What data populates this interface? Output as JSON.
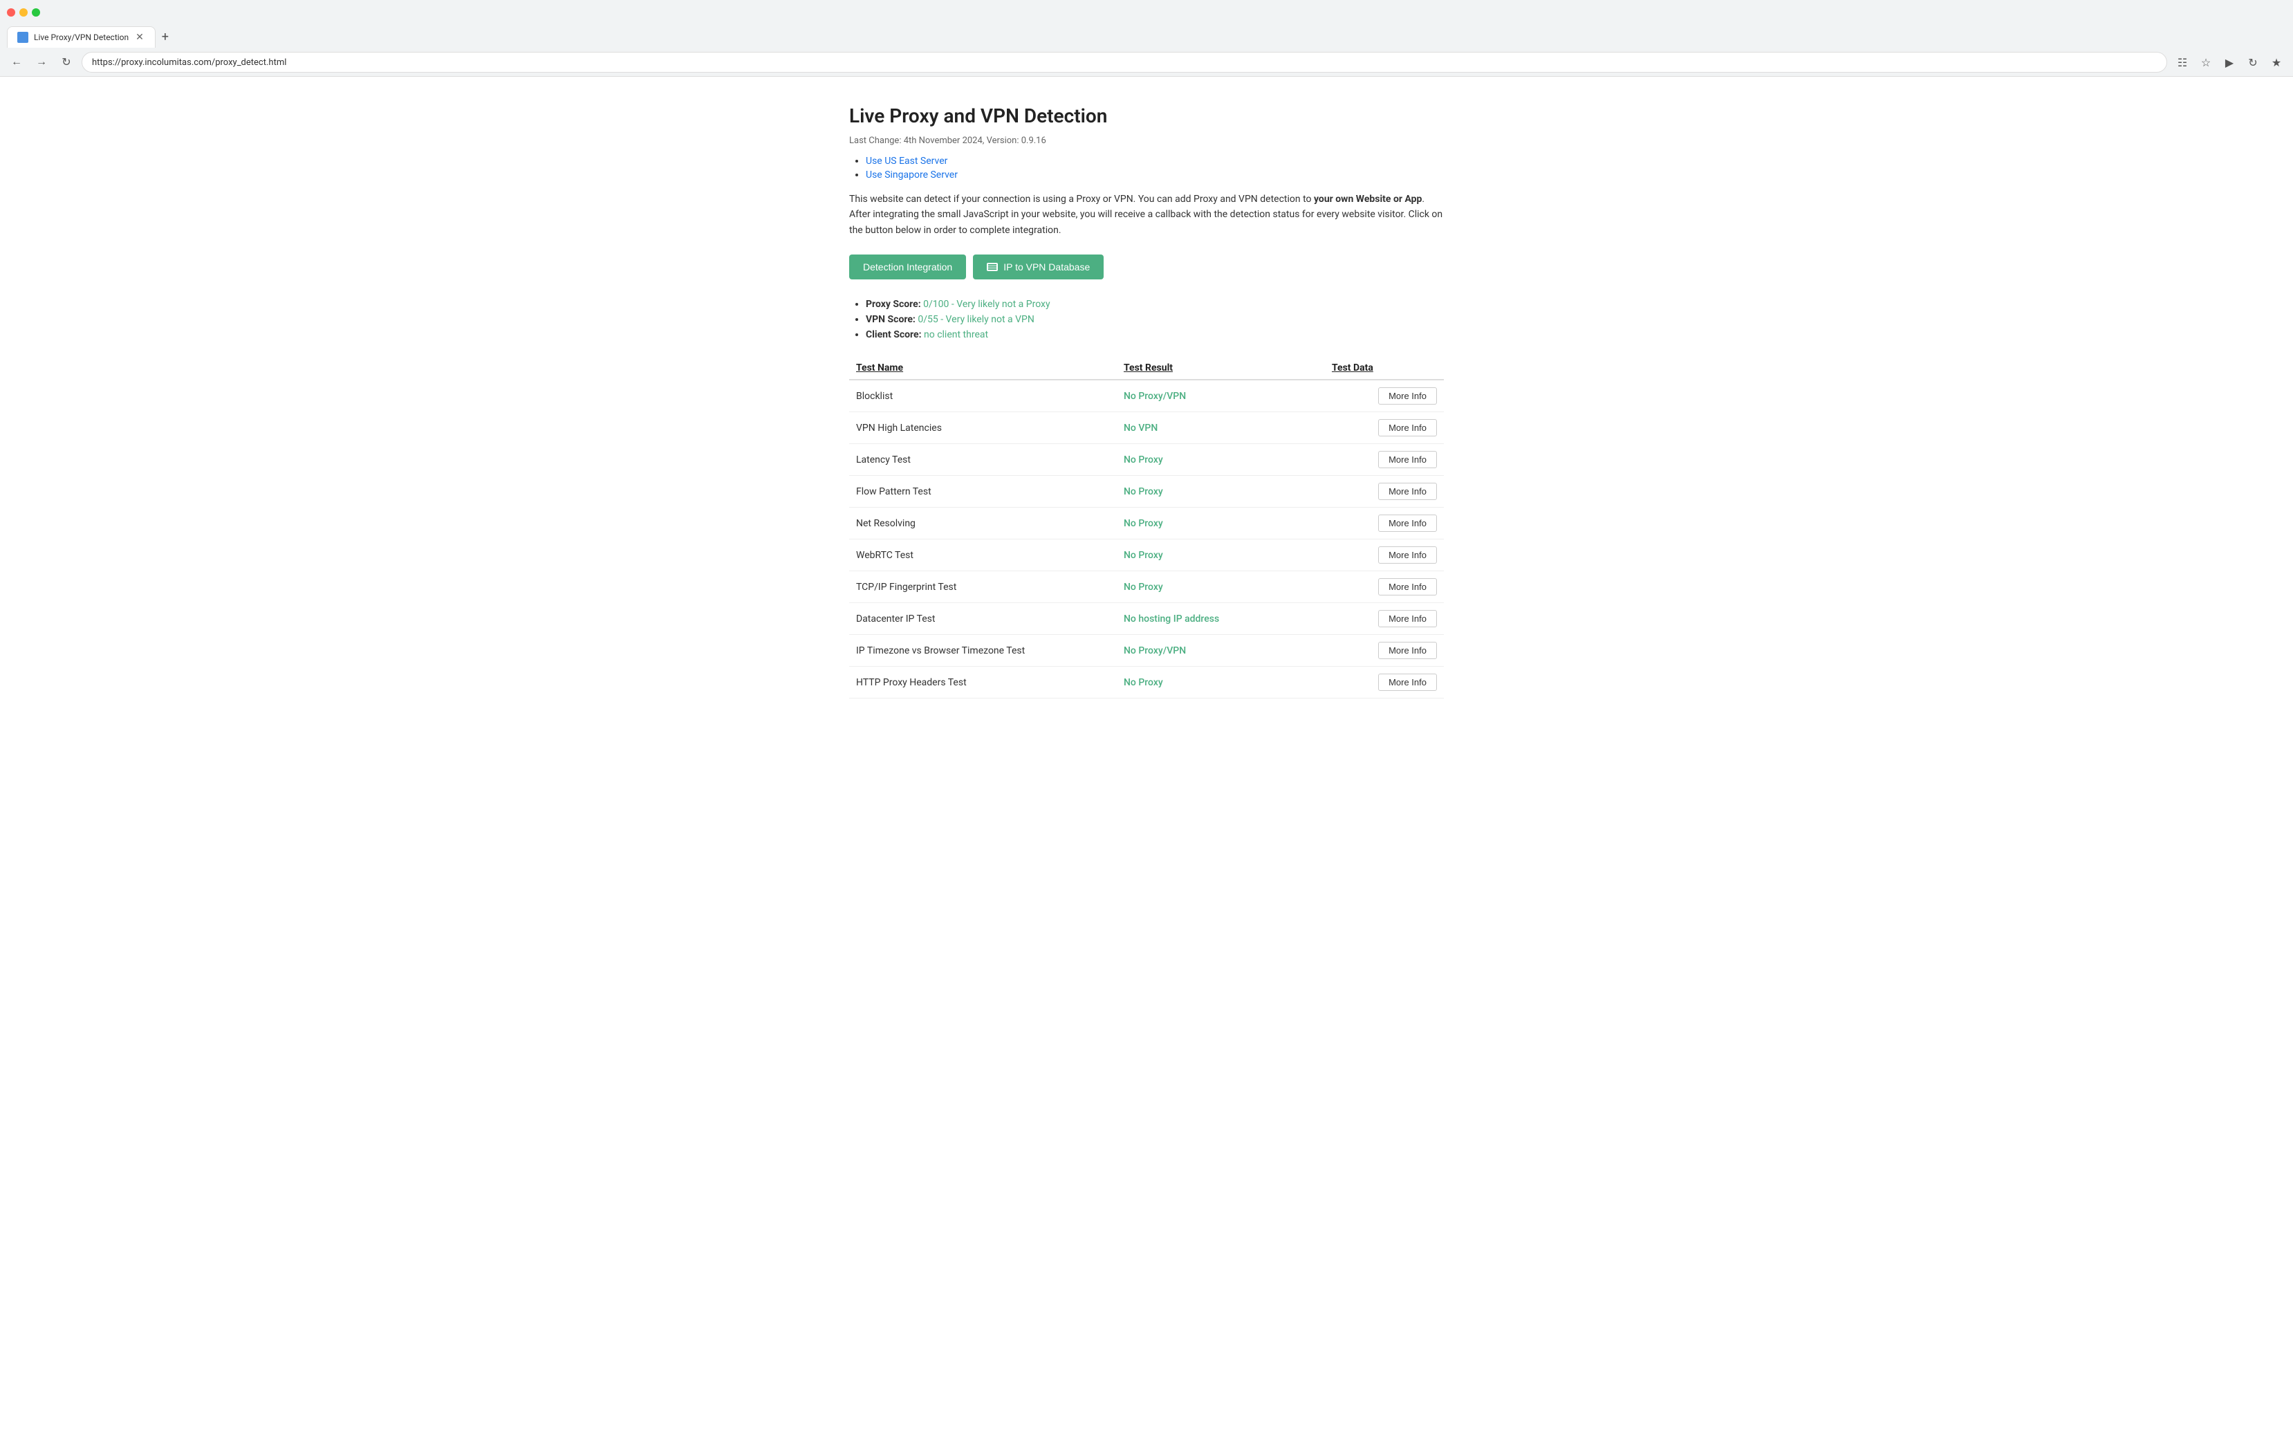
{
  "browser": {
    "tab_title": "Live Proxy/VPN Detection",
    "url": "https://proxy.incolumitas.com/proxy_detect.html",
    "new_tab_label": "+"
  },
  "page": {
    "title": "Live Proxy and VPN Detection",
    "last_change": "Last Change: 4th November 2024, Version: 0.9.16",
    "server_links": [
      {
        "label": "Use US East Server",
        "href": "#"
      },
      {
        "label": "Use Singapore Server",
        "href": "#"
      }
    ],
    "description_part1": "This website can detect if your connection is using a Proxy or VPN. You can add Proxy and VPN detection to ",
    "description_bold": "your own Website or App",
    "description_part2": ". After integrating the small JavaScript in your website, you will receive a callback with the detection status for every website visitor. Click on the button below in order to complete integration.",
    "buttons": {
      "detection_integration": "Detection Integration",
      "ip_to_vpn_db": "IP to VPN Database"
    },
    "scores": {
      "proxy_label": "Proxy Score:",
      "proxy_value": "0/100 - Very likely not a Proxy",
      "vpn_label": "VPN Score:",
      "vpn_value": "0/55 - Very likely not a VPN",
      "client_label": "Client Score:",
      "client_value": "no client threat"
    },
    "table": {
      "headers": {
        "name": "Test Name",
        "result": "Test Result",
        "data": "Test Data"
      },
      "rows": [
        {
          "name": "Blocklist",
          "result": "No Proxy/VPN",
          "more_info": "More Info"
        },
        {
          "name": "VPN High Latencies",
          "result": "No VPN",
          "more_info": "More Info"
        },
        {
          "name": "Latency Test",
          "result": "No Proxy",
          "more_info": "More Info"
        },
        {
          "name": "Flow Pattern Test",
          "result": "No Proxy",
          "more_info": "More Info"
        },
        {
          "name": "Net Resolving",
          "result": "No Proxy",
          "more_info": "More Info"
        },
        {
          "name": "WebRTC Test",
          "result": "No Proxy",
          "more_info": "More Info"
        },
        {
          "name": "TCP/IP Fingerprint Test",
          "result": "No Proxy",
          "more_info": "More Info"
        },
        {
          "name": "Datacenter IP Test",
          "result": "No hosting IP address",
          "more_info": "More Info"
        },
        {
          "name": "IP Timezone vs Browser Timezone Test",
          "result": "No Proxy/VPN",
          "more_info": "More Info"
        },
        {
          "name": "HTTP Proxy Headers Test",
          "result": "No Proxy",
          "more_info": "More Info"
        }
      ]
    }
  }
}
